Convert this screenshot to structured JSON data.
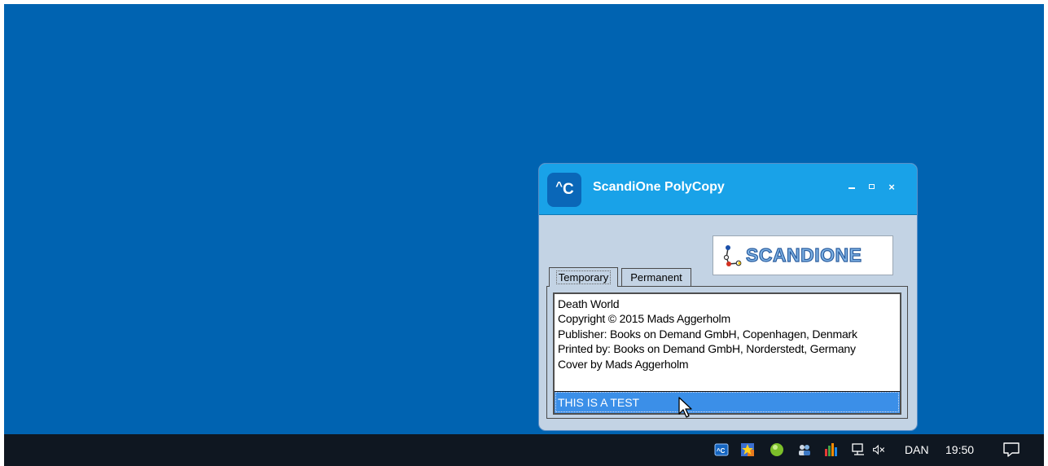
{
  "window": {
    "title": "ScandiOne PolyCopy",
    "icon_text": "C",
    "icon_caret": "^",
    "minimize_icon": "minimize-icon",
    "maximize_icon": "maximize-icon",
    "close_glyph": "×"
  },
  "logo": {
    "text": "SCANDIONE"
  },
  "tabs": [
    {
      "label": "Temporary",
      "selected": true
    },
    {
      "label": "Permanent",
      "selected": false
    }
  ],
  "clipboard": {
    "lines": [
      "Death World",
      "Copyright © 2015 Mads Aggerholm",
      "Publisher: Books on Demand GmbH, Copenhagen, Denmark",
      "Printed by: Books on Demand GmbH, Norderstedt, Germany",
      "Cover by Mads Aggerholm"
    ],
    "selected_item": "THIS IS A TEST"
  },
  "taskbar": {
    "tray_icons": [
      "polycopy-tray-icon",
      "star-app-icon",
      "green-orb-icon",
      "people-icon",
      "bars-app-icon",
      "network-icon",
      "volume-muted-icon"
    ],
    "language": "DAN",
    "time": "19:50",
    "notification_icon": "action-center-icon"
  },
  "colors": {
    "desktop": "#0063b1",
    "titlebar": "#19a2e8",
    "window_body": "#c3d3e4",
    "selection": "#3b8fe8",
    "taskbar": "#0f1721"
  }
}
